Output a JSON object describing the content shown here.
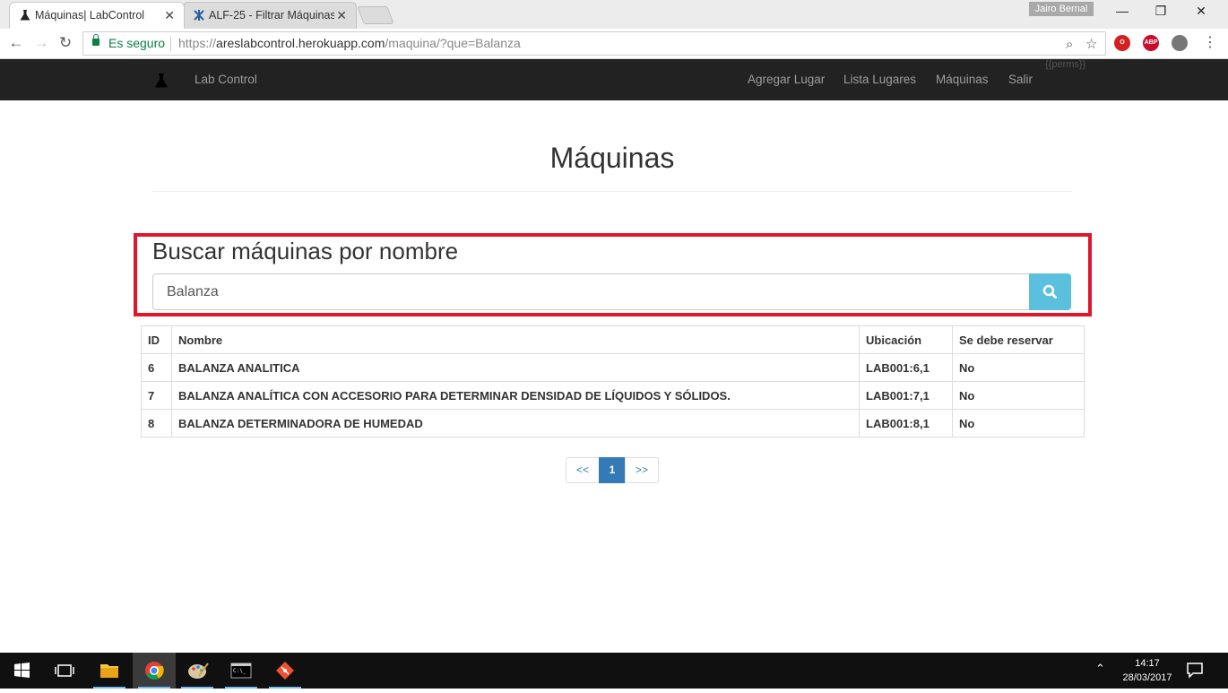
{
  "browser": {
    "tabs": [
      {
        "title": "Máquinas| LabControl",
        "active": true,
        "icon": "flask-icon"
      },
      {
        "title": "ALF-25 - Filtrar Máquinas",
        "active": false,
        "icon": "jira-icon"
      }
    ],
    "profile_name": "Jairo Bernal",
    "security_label": "Es seguro",
    "url_scheme": "https://",
    "url_host": "areslabcontrol.herokuapp.com",
    "url_path": "/maquina/?que=Balanza",
    "extensions": [
      {
        "name": "opera-icon",
        "color": "#d51f21"
      },
      {
        "name": "adblock-plus-icon",
        "label": "ABP",
        "color": "#c70d2c"
      },
      {
        "name": "extension-icon",
        "color": "#777777"
      }
    ]
  },
  "site": {
    "brand": "Lab Control",
    "nav": [
      "Agregar Lugar",
      "Lista Lugares",
      "Máquinas",
      "Salir"
    ],
    "perms_text": "{{perms}}"
  },
  "page": {
    "title": "Máquinas",
    "search_title": "Buscar máquinas por nombre",
    "search_value": "Balanza",
    "highlight_color": "#e0172b"
  },
  "table": {
    "headers": [
      "ID",
      "Nombre",
      "Ubicación",
      "Se debe reservar"
    ],
    "rows": [
      [
        "6",
        "BALANZA ANALITICA",
        "LAB001:6,1",
        "No"
      ],
      [
        "7",
        "BALANZA ANALÍTICA CON ACCESORIO PARA DETERMINAR DENSIDAD DE LÍQUIDOS Y SÓLIDOS.",
        "LAB001:7,1",
        "No"
      ],
      [
        "8",
        "BALANZA DETERMINADORA DE HUMEDAD",
        "LAB001:8,1",
        "No"
      ]
    ]
  },
  "pagination": {
    "prev": "<<",
    "current": "1",
    "next": ">>"
  },
  "taskbar": {
    "time": "14:17",
    "date": "28/03/2017",
    "apps": [
      "windows-start-icon",
      "task-view-icon",
      "file-explorer-icon",
      "chrome-icon",
      "paint-icon",
      "terminal-icon",
      "git-icon"
    ]
  }
}
